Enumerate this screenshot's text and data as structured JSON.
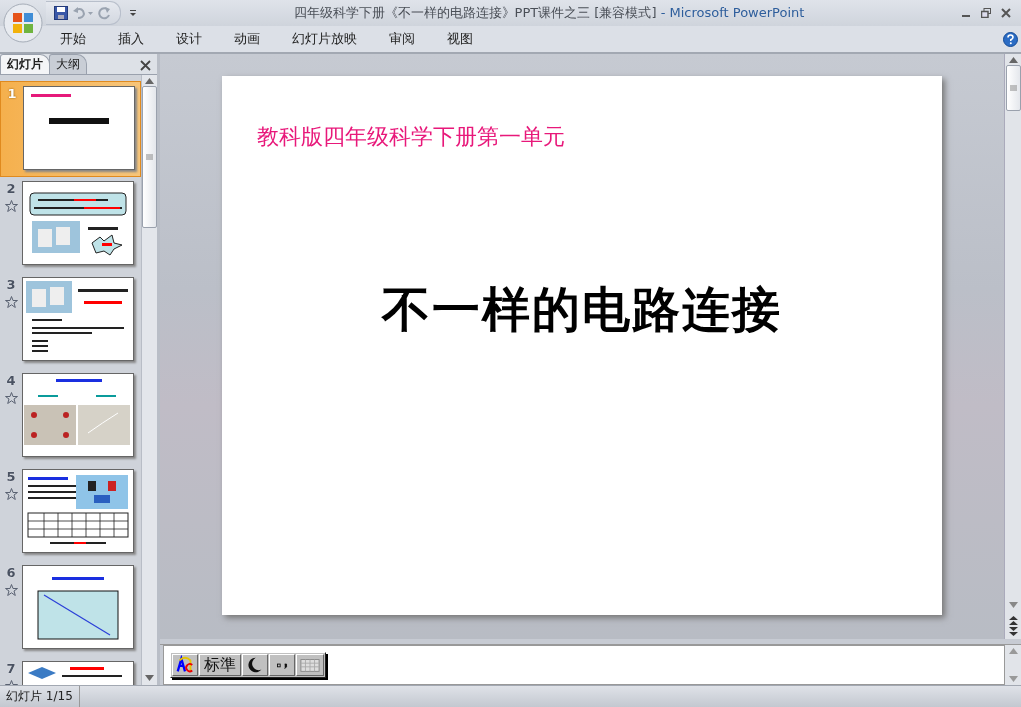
{
  "window": {
    "document_title": "四年级科学下册《不一样的电路连接》PPT课件之三 [兼容模式]",
    "separator": "-",
    "app_name": "Microsoft PowerPoint"
  },
  "ribbon_tabs": [
    {
      "label": "开始",
      "selected": false
    },
    {
      "label": "插入",
      "selected": false
    },
    {
      "label": "设计",
      "selected": false
    },
    {
      "label": "动画",
      "selected": false
    },
    {
      "label": "幻灯片放映",
      "selected": false
    },
    {
      "label": "审阅",
      "selected": false
    },
    {
      "label": "视图",
      "selected": false
    }
  ],
  "panel_tabs": [
    {
      "label": "幻灯片",
      "selected": true
    },
    {
      "label": "大纲",
      "selected": false
    }
  ],
  "slides": [
    {
      "number": "1",
      "selected": true,
      "animated": false,
      "kind": "title"
    },
    {
      "number": "2",
      "selected": false,
      "animated": true,
      "kind": "callout"
    },
    {
      "number": "3",
      "selected": false,
      "animated": true,
      "kind": "photo-list"
    },
    {
      "number": "4",
      "selected": false,
      "animated": true,
      "kind": "photos"
    },
    {
      "number": "5",
      "selected": false,
      "animated": true,
      "kind": "table"
    },
    {
      "number": "6",
      "selected": false,
      "animated": true,
      "kind": "diagram"
    },
    {
      "number": "7",
      "selected": false,
      "animated": true,
      "kind": "mixed"
    }
  ],
  "slide": {
    "subtitle": "教科版四年级科学下册第一单元",
    "title": "不一样的电路连接"
  },
  "ime": {
    "mode": "标準"
  },
  "status_bar": {
    "slide_counter": "幻灯片 1/15"
  }
}
